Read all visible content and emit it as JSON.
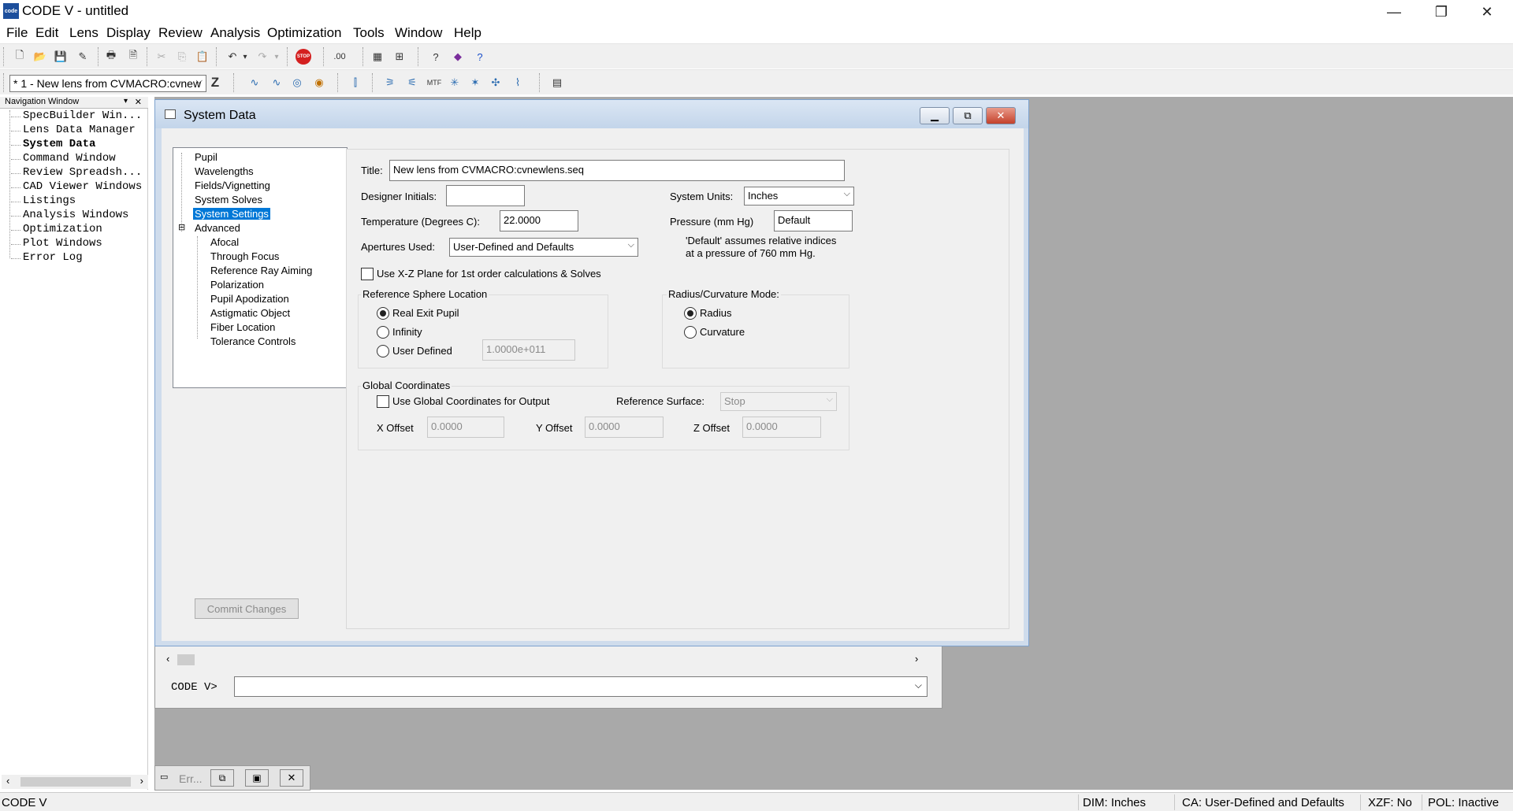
{
  "app": {
    "title": "CODE V - untitled",
    "icon_text": "code"
  },
  "menu": [
    "File",
    "Edit",
    "Lens",
    "Display",
    "Review",
    "Analysis",
    "Optimization",
    "Tools",
    "Window",
    "Help"
  ],
  "toolbar2": {
    "lens_select": "* 1 - New lens from CVMACRO:cvnew",
    "z_label": "Z"
  },
  "nav": {
    "header": "Navigation Window",
    "items": [
      "SpecBuilder Win...",
      "Lens Data Manager",
      "System Data",
      "Command Window",
      "Review Spreadsh...",
      "CAD Viewer Windows",
      "Listings",
      "Analysis Windows",
      "Optimization",
      "Plot Windows",
      "Error Log"
    ]
  },
  "sysdata": {
    "title": "System Data",
    "tree": {
      "items": [
        "Pupil",
        "Wavelengths",
        "Fields/Vignetting",
        "System Solves",
        "System Settings",
        "Advanced"
      ],
      "advanced_items": [
        "Afocal",
        "Through Focus",
        "Reference Ray Aiming",
        "Polarization",
        "Pupil Apodization",
        "Astigmatic Object",
        "Fiber Location",
        "Tolerance Controls"
      ],
      "selected": "System Settings",
      "expander": "⊟"
    },
    "title_label": "Title:",
    "title_value": "New lens from CVMACRO:cvnewlens.seq",
    "designer_label": "Designer Initials:",
    "designer_value": "",
    "units_label": "System Units:",
    "units_value": "Inches",
    "temp_label": "Temperature (Degrees C):",
    "temp_value": "22.0000",
    "pressure_label": "Pressure (mm Hg)",
    "pressure_value": "Default",
    "apertures_label": "Apertures Used:",
    "apertures_value": "User-Defined and Defaults",
    "pressure_note_1": "'Default' assumes relative indices",
    "pressure_note_2": "at a pressure of 760 mm Hg.",
    "xz_label": "Use X-Z Plane for 1st order calculations & Solves",
    "ref_sphere": {
      "title": "Reference Sphere Location",
      "options": [
        "Real Exit Pupil",
        "Infinity",
        "User Defined"
      ],
      "selected": "Real Exit Pupil",
      "user_value": "1.0000e+011"
    },
    "radius_mode": {
      "title": "Radius/Curvature Mode:",
      "options": [
        "Radius",
        "Curvature"
      ],
      "selected": "Radius"
    },
    "global": {
      "title": "Global Coordinates",
      "use_label": "Use Global Coordinates for Output",
      "ref_surface_label": "Reference Surface:",
      "ref_surface_value": "Stop",
      "x_label": "X Offset",
      "x_value": "0.0000",
      "y_label": "Y Offset",
      "y_value": "0.0000",
      "z_label": "Z Offset",
      "z_value": "0.0000"
    },
    "commit": "Commit Changes"
  },
  "cmd": {
    "prompt": "CODE V>",
    "value": ""
  },
  "err_tab": {
    "label": "Err..."
  },
  "status": {
    "left": "CODE V",
    "dim": "DIM: Inches",
    "ca": "CA: User-Defined and Defaults",
    "xzf": "XZF: No",
    "pol": "POL: Inactive"
  }
}
